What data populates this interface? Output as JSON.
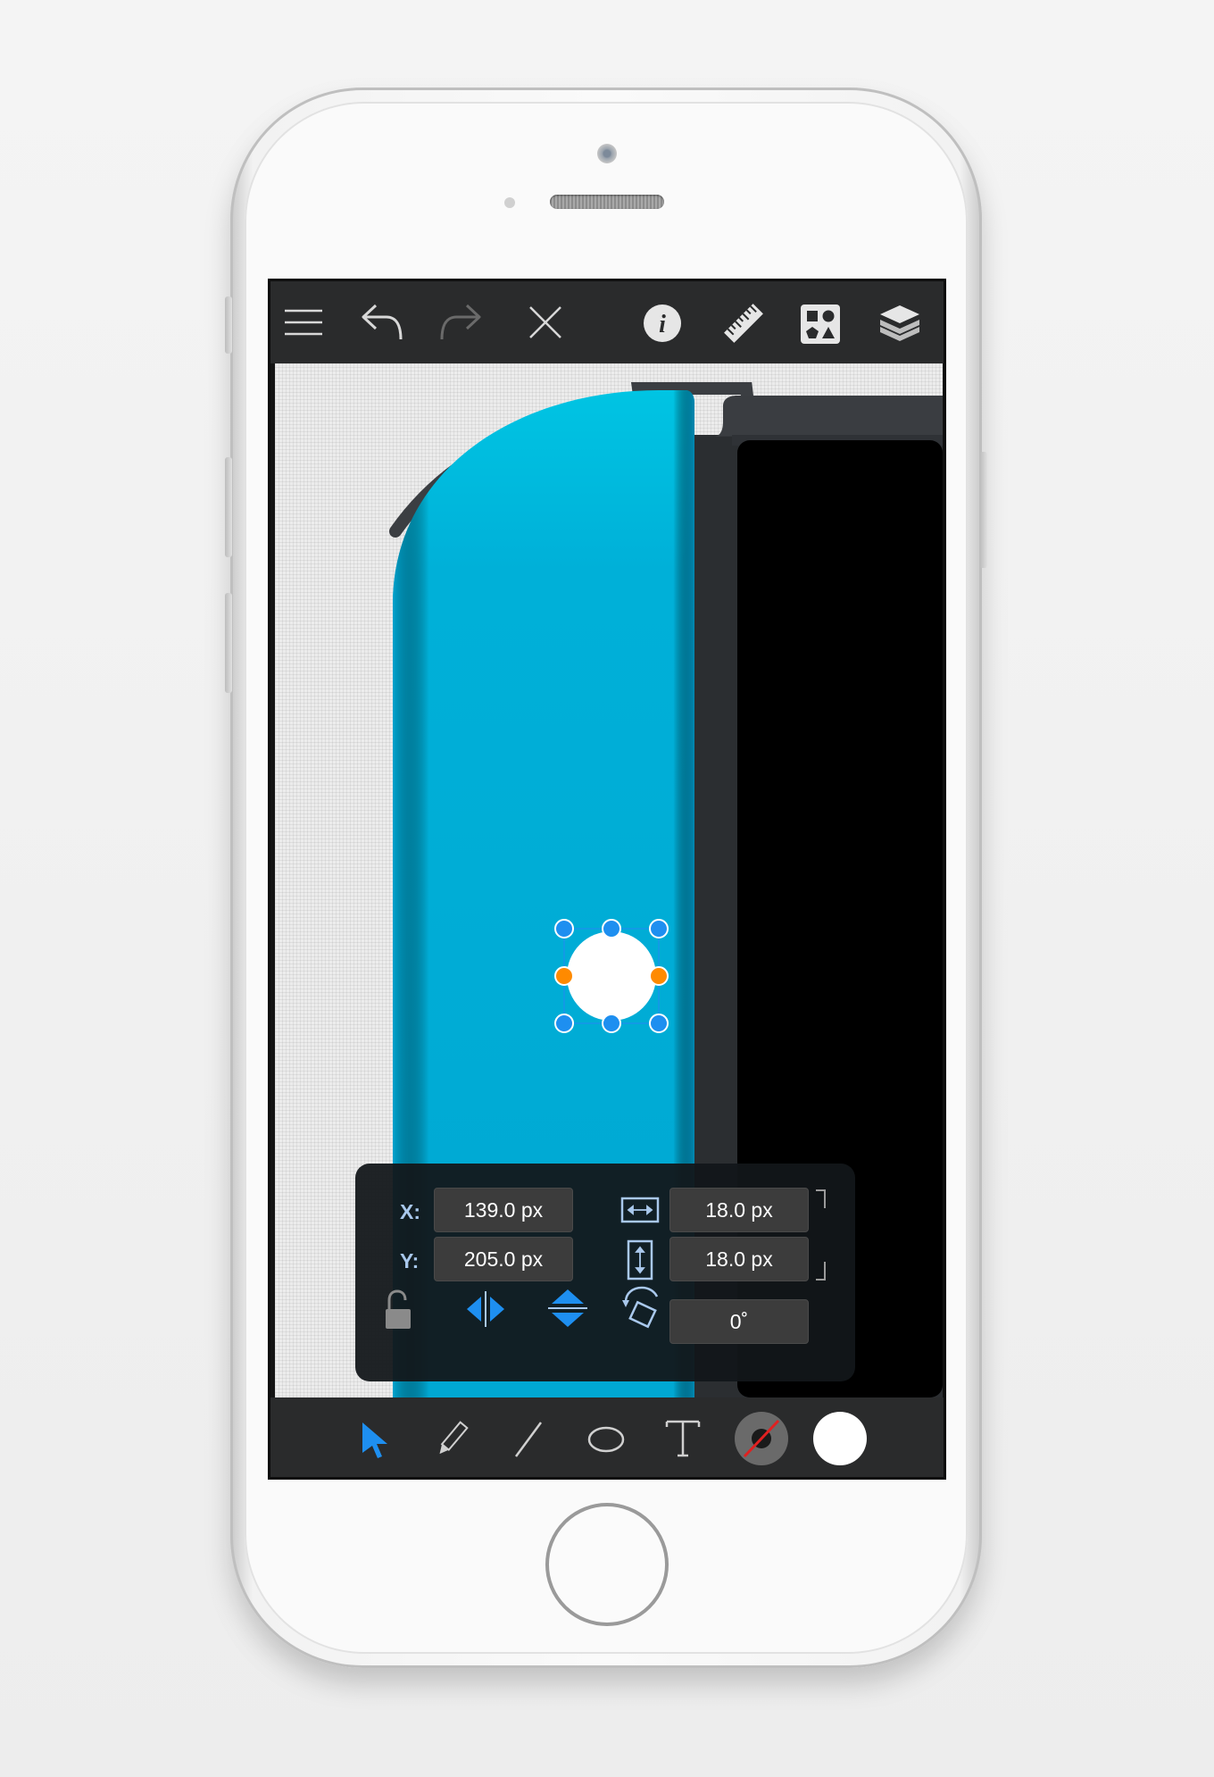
{
  "toolbar": {
    "buttons": [
      "menu",
      "undo",
      "redo",
      "close",
      "info",
      "ruler",
      "shapes",
      "layers"
    ]
  },
  "properties": {
    "x_label": "X:",
    "y_label": "Y:",
    "x_value": "139.0 px",
    "y_value": "205.0 px",
    "width_value": "18.0 px",
    "height_value": "18.0 px",
    "rotation_value": "0˚"
  },
  "tools": [
    "select",
    "pencil",
    "line",
    "ellipse",
    "text",
    "stroke-color",
    "fill-color"
  ],
  "colors": {
    "accent": "#1e8ff0",
    "handle_orange": "#ff8a00",
    "shape_blue": "#00aad3",
    "fill_color": "#ffffff"
  }
}
